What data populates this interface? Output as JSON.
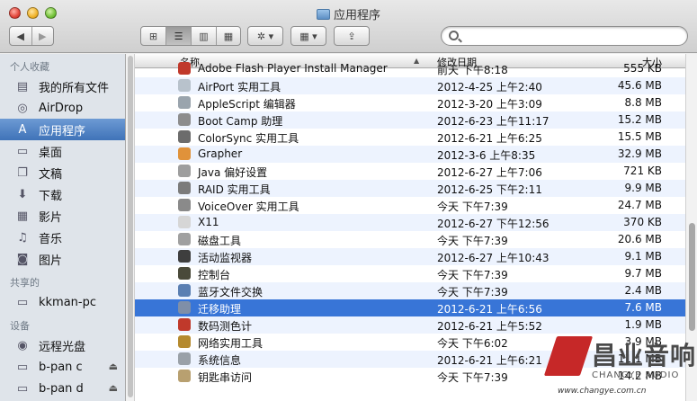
{
  "window": {
    "title": "应用程序"
  },
  "toolbar": {
    "back": "◀",
    "forward": "▶",
    "views": [
      "⊞",
      "☰",
      "▥",
      "▦"
    ],
    "action": "✲ ▾",
    "arrange": "▦ ▾",
    "share": "⇪",
    "search_placeholder": ""
  },
  "sidebar": {
    "sections": [
      {
        "title": "个人收藏",
        "items": [
          {
            "label": "我的所有文件",
            "icon": "all-files-icon",
            "glyph": "▤"
          },
          {
            "label": "AirDrop",
            "icon": "airdrop-icon",
            "glyph": "◎"
          },
          {
            "label": "应用程序",
            "icon": "applications-icon",
            "glyph": "A",
            "selected": true
          },
          {
            "label": "桌面",
            "icon": "desktop-icon",
            "glyph": "▭"
          },
          {
            "label": "文稿",
            "icon": "documents-icon",
            "glyph": "❐"
          },
          {
            "label": "下载",
            "icon": "downloads-icon",
            "glyph": "⬇"
          },
          {
            "label": "影片",
            "icon": "movies-icon",
            "glyph": "▦"
          },
          {
            "label": "音乐",
            "icon": "music-icon",
            "glyph": "♫"
          },
          {
            "label": "图片",
            "icon": "pictures-icon",
            "glyph": "◙"
          }
        ]
      },
      {
        "title": "共享的",
        "items": [
          {
            "label": "kkman-pc",
            "icon": "computer-icon",
            "glyph": "▭"
          }
        ]
      },
      {
        "title": "设备",
        "items": [
          {
            "label": "远程光盘",
            "icon": "disc-icon",
            "glyph": "◉"
          },
          {
            "label": "b-pan c",
            "icon": "drive-icon",
            "glyph": "▭",
            "eject": "⏏"
          },
          {
            "label": "b-pan d",
            "icon": "drive-icon",
            "glyph": "▭",
            "eject": "⏏"
          }
        ]
      }
    ]
  },
  "list": {
    "columns": {
      "name": "名称",
      "date": "修改日期",
      "size": "大小"
    },
    "rows": [
      {
        "name": "Adobe Flash Player Install Manager",
        "date": "前天 下午8:18",
        "size": "555 KB",
        "icon": "flash-icon",
        "color": "#c0392b"
      },
      {
        "name": "AirPort 实用工具",
        "date": "2012-4-25 上午2:40",
        "size": "45.6 MB",
        "icon": "airport-icon",
        "color": "#b8c2cc"
      },
      {
        "name": "AppleScript 编辑器",
        "date": "2012-3-20 上午3:09",
        "size": "8.8 MB",
        "icon": "applescript-icon",
        "color": "#9aa4ad"
      },
      {
        "name": "Boot Camp 助理",
        "date": "2012-6-23 上午11:17",
        "size": "15.2 MB",
        "icon": "bootcamp-icon",
        "color": "#8d8d8d"
      },
      {
        "name": "ColorSync 实用工具",
        "date": "2012-6-21 上午6:25",
        "size": "15.5 MB",
        "icon": "colorsync-icon",
        "color": "#6c6c6c"
      },
      {
        "name": "Grapher",
        "date": "2012-3-6 上午8:35",
        "size": "32.9 MB",
        "icon": "grapher-icon",
        "color": "#e0923a"
      },
      {
        "name": "Java 偏好设置",
        "date": "2012-6-27 上午7:06",
        "size": "721 KB",
        "icon": "java-icon",
        "color": "#9e9e9e"
      },
      {
        "name": "RAID 实用工具",
        "date": "2012-6-25 下午2:11",
        "size": "9.9 MB",
        "icon": "raid-icon",
        "color": "#7b7b7b"
      },
      {
        "name": "VoiceOver 实用工具",
        "date": "今天 下午7:39",
        "size": "24.7 MB",
        "icon": "voiceover-icon",
        "color": "#8a8a8a"
      },
      {
        "name": "X11",
        "date": "2012-6-27 下午12:56",
        "size": "370 KB",
        "icon": "x11-icon",
        "color": "#d6d6d6"
      },
      {
        "name": "磁盘工具",
        "date": "今天 下午7:39",
        "size": "20.6 MB",
        "icon": "disk-utility-icon",
        "color": "#a0a0a0"
      },
      {
        "name": "活动监视器",
        "date": "2012-6-27 上午10:43",
        "size": "9.1 MB",
        "icon": "activity-monitor-icon",
        "color": "#3e3e3e"
      },
      {
        "name": "控制台",
        "date": "今天 下午7:39",
        "size": "9.7 MB",
        "icon": "console-icon",
        "color": "#4a4a3a"
      },
      {
        "name": "蓝牙文件交换",
        "date": "今天 下午7:39",
        "size": "2.4 MB",
        "icon": "bluetooth-icon",
        "color": "#5a7fb2"
      },
      {
        "name": "迁移助理",
        "date": "2012-6-21 上午6:56",
        "size": "7.6 MB",
        "icon": "migration-icon",
        "color": "#7f8fa8",
        "selected": true
      },
      {
        "name": "数码测色计",
        "date": "2012-6-21 上午5:52",
        "size": "1.9 MB",
        "icon": "color-meter-icon",
        "color": "#c0392b"
      },
      {
        "name": "网络实用工具",
        "date": "今天 下午6:02",
        "size": "3.9 MB",
        "icon": "network-utility-icon",
        "color": "#b58a2e"
      },
      {
        "name": "系统信息",
        "date": "2012-6-21 上午6:21",
        "size": "11.1 MB",
        "icon": "system-info-icon",
        "color": "#9aa1a8"
      },
      {
        "name": "钥匙串访问",
        "date": "今天 下午7:39",
        "size": "14.2 MB",
        "icon": "keychain-icon",
        "color": "#b8a070"
      }
    ]
  },
  "watermark": {
    "text": "昌业音响",
    "sub": "CHANGYE AUDIO",
    "url": "www.changye.com.cn"
  }
}
